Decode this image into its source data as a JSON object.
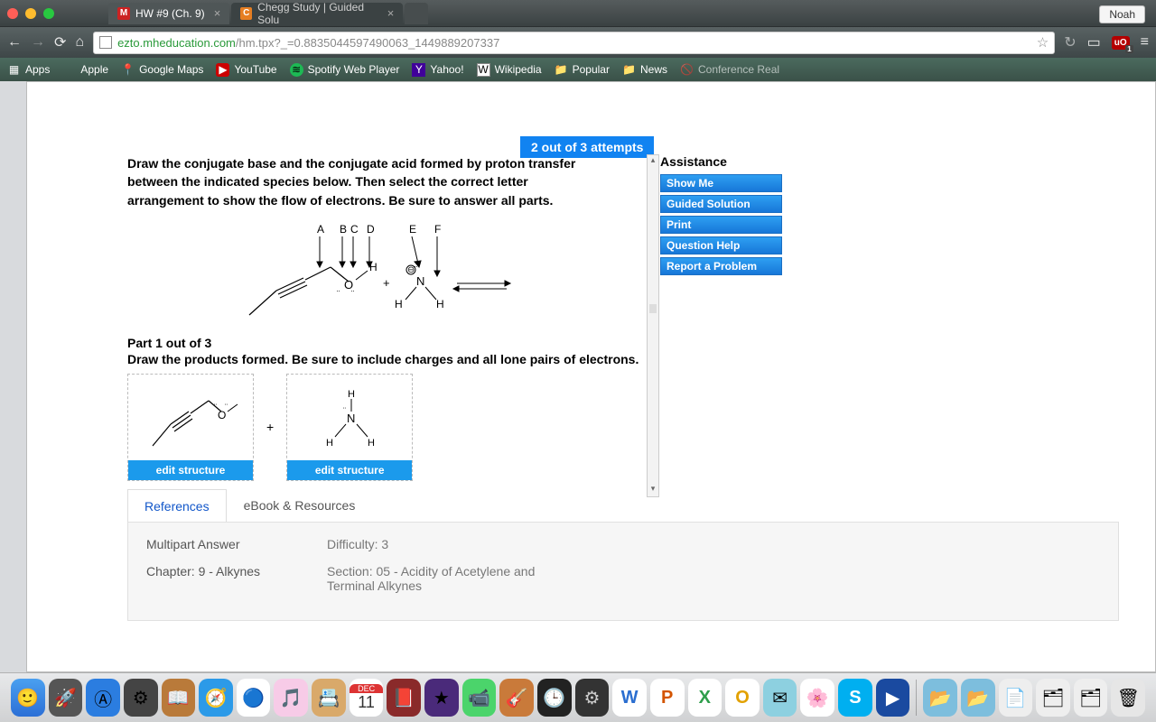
{
  "profile_name": "Noah",
  "tabs": [
    {
      "label": "HW #9 (Ch. 9)",
      "favicon_bg": "#c22",
      "favicon_text": "M",
      "active": true
    },
    {
      "label": "Chegg Study | Guided Solu",
      "favicon_bg": "#e67e22",
      "favicon_text": "C",
      "active": false
    }
  ],
  "url": {
    "host": "ezto.mheducation.com",
    "path": "/hm.tpx?_=0.8835044597490063_1449889207337"
  },
  "bookmarks": [
    {
      "label": "Apps"
    },
    {
      "label": "Apple"
    },
    {
      "label": "Google Maps"
    },
    {
      "label": "YouTube"
    },
    {
      "label": "Spotify Web Player"
    },
    {
      "label": "Yahoo!"
    },
    {
      "label": "Wikipedia"
    },
    {
      "label": "Popular"
    },
    {
      "label": "News"
    },
    {
      "label": "Conference Real"
    }
  ],
  "attempts_text": "2 out of 3 attempts",
  "question_text": "Draw the conjugate base and the conjugate acid formed by proton transfer between the indicated species below. Then select the correct letter arrangement to show the flow of electrons. Be sure to answer all parts.",
  "diagram_labels": [
    "A",
    "B",
    "C",
    "D",
    "E",
    "F"
  ],
  "part_title": "Part 1 out of 3",
  "part_instr": "Draw the products formed. Be sure to include charges and all lone pairs of electrons.",
  "plus_sign": "+",
  "edit_label": "edit structure",
  "assist_title": "Assistance",
  "assist_buttons": [
    "Show Me",
    "Guided Solution",
    "Print",
    "Question Help",
    "Report a Problem"
  ],
  "ref_tabs": [
    "References",
    "eBook & Resources"
  ],
  "ref_rows": [
    {
      "k": "Multipart Answer",
      "v": "Difficulty: 3"
    },
    {
      "k": "Chapter: 9 - Alkynes",
      "v": "Section: 05 - Acidity of Acetylene and Terminal Alkynes"
    }
  ],
  "dock_apps": [
    "😀",
    "🚀",
    "🅰️",
    "⚙️",
    "📖",
    "🧭",
    "🟢",
    "🎵",
    "📁",
    "📅",
    "📕",
    "⭐",
    "💬",
    "🎸",
    "🕒",
    "⚙",
    "W",
    "P",
    "X",
    "O",
    "📧",
    "🌸",
    "S",
    "▶"
  ],
  "calendar_day": "11",
  "calendar_month": "DEC"
}
